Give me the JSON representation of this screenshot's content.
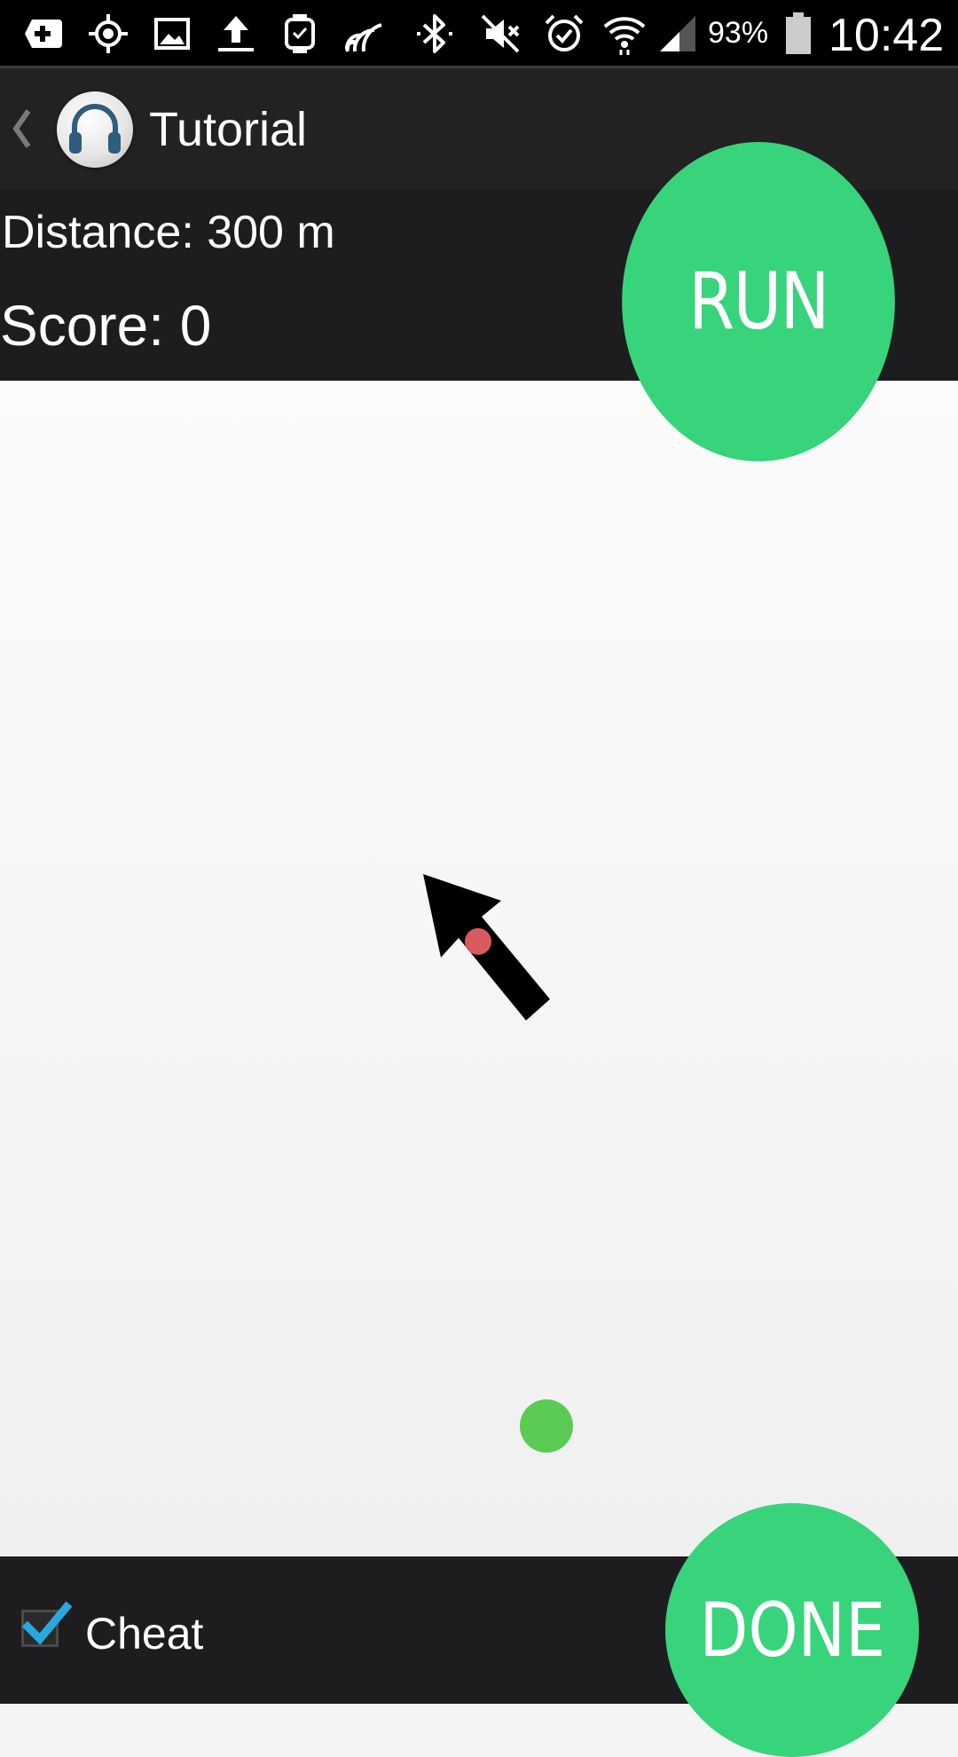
{
  "status_bar": {
    "icons": [
      "add-icon",
      "gps-icon",
      "image-icon",
      "upload-icon",
      "smartwatch-icon",
      "nfc-signal-icon",
      "bluetooth-icon",
      "mute-icon",
      "alarm-icon",
      "wifi-icon",
      "cell-signal-icon",
      "battery-icon"
    ],
    "battery_percent": "93%",
    "time": "10:42"
  },
  "action_bar": {
    "title": "Tutorial",
    "back_icon": "chevron-left-icon",
    "app_icon": "headphones-icon"
  },
  "info": {
    "distance": "Distance: 300 m",
    "score": "Score: 0"
  },
  "buttons": {
    "run_label": "RUN",
    "done_label": "DONE"
  },
  "play_area": {
    "direction_icon": "arrow-icon",
    "colors": {
      "player_dot": "#d75a5e",
      "target_dot": "#5ccb54",
      "arrow": "#000000"
    }
  },
  "footer": {
    "cheat_label": "Cheat",
    "cheat_checked": true
  },
  "colors": {
    "accent": "#37d47b",
    "bar_background": "#1d1d1f",
    "checkmark": "#29a8e0"
  }
}
